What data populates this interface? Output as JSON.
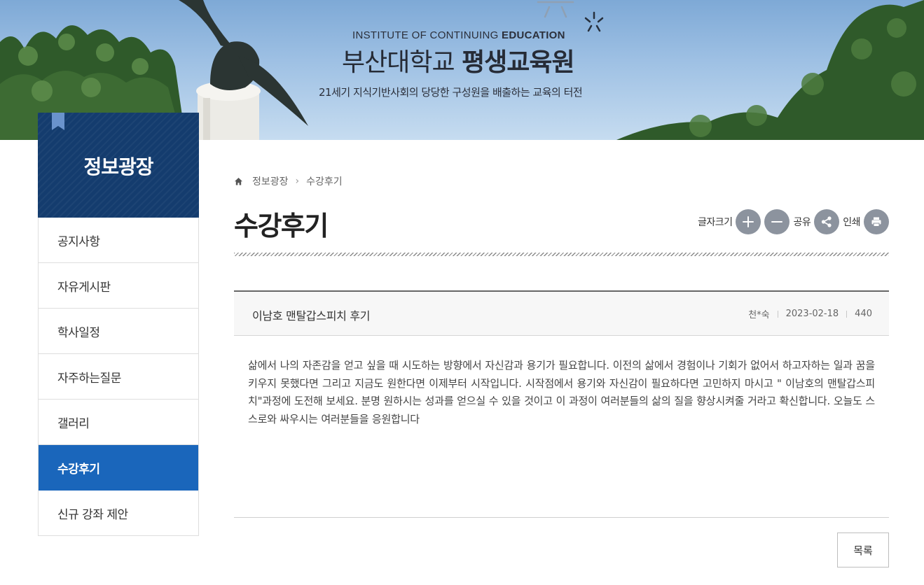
{
  "header": {
    "en_prefix": "INSTITUTE OF CONTINUING",
    "en_bold": "EDUCATION",
    "title_regular": "부산대학교",
    "title_bold": "평생교육원",
    "slogan": "21세기 지식기반사회의 당당한 구성원을 배출하는 교육의 터전"
  },
  "sidebar": {
    "title": "정보광장",
    "items": [
      {
        "label": "공지사항",
        "active": false
      },
      {
        "label": "자유게시판",
        "active": false
      },
      {
        "label": "학사일정",
        "active": false
      },
      {
        "label": "자주하는질문",
        "active": false
      },
      {
        "label": "갤러리",
        "active": false
      },
      {
        "label": "수강후기",
        "active": true
      },
      {
        "label": "신규 강좌 제안",
        "active": false
      }
    ]
  },
  "breadcrumb": {
    "icon": "home-icon",
    "items": [
      "정보광장",
      "수강후기"
    ]
  },
  "page": {
    "title": "수강후기"
  },
  "tools": {
    "font_size_label": "글자크기",
    "share_label": "공유",
    "print_label": "인쇄"
  },
  "post": {
    "title": "이남호 맨탈갑스피치 후기",
    "author": "천*숙",
    "date": "2023-02-18",
    "views": "440",
    "body": "삶에서 나의 자존감을 얻고 싶을 때 시도하는 방향에서 자신감과 용기가 필요합니다.   이전의 삶에서 경험이나 기회가 없어서 하고자하는 일과 꿈을 키우지 못했다면 그리고 지금도 원한다면 이제부터 시작입니다. 시작점에서 용기와 자신감이 필요하다면 고민하지 마시고 \" 이남호의 맨탈갑스피치\"과정에 도전해 보세요. 분명 원하시는 성과를 얻으실 수 있을 것이고 이 과정이 여러분들의 삶의 질을 향상시켜줄 거라고 확신합니다. 오늘도 스스로와 싸우시는 여러분들을 응원합니다"
  },
  "actions": {
    "list_label": "목록"
  },
  "colors": {
    "sidebar_header": "#143c6e",
    "active_menu": "#1a66bb",
    "tool_button": "#8c939e"
  }
}
